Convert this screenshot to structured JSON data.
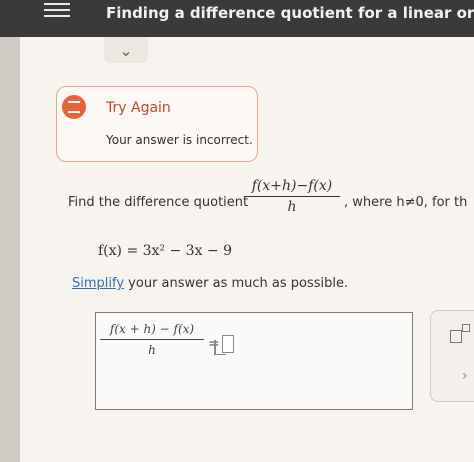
{
  "header": {
    "title": "Finding a difference quotient for a linear or quadratic fu",
    "menu_icon": "hamburger-icon",
    "collapse_icon": "chevron-down-icon"
  },
  "alert": {
    "icon": "feedback-icon",
    "title": "Try Again",
    "message": "Your answer is incorrect.",
    "accent_color": "#e8623e"
  },
  "question": {
    "prefix": "Find the difference quotient",
    "fraction_numerator": "f(x+h)−f(x)",
    "fraction_denominator": "h",
    "suffix": ", where h≠0, for th",
    "function": "f(x) = 3x² − 3x − 9",
    "instruction_link": "Simplify",
    "instruction_rest": " your answer as much as possible."
  },
  "answer": {
    "numerator": "f(x + h) − f(x)",
    "denominator": "h",
    "equals": "="
  },
  "toolbar": {
    "exponent_icon": "exponent-icon",
    "arrow_icon": "chevron-right-icon"
  }
}
